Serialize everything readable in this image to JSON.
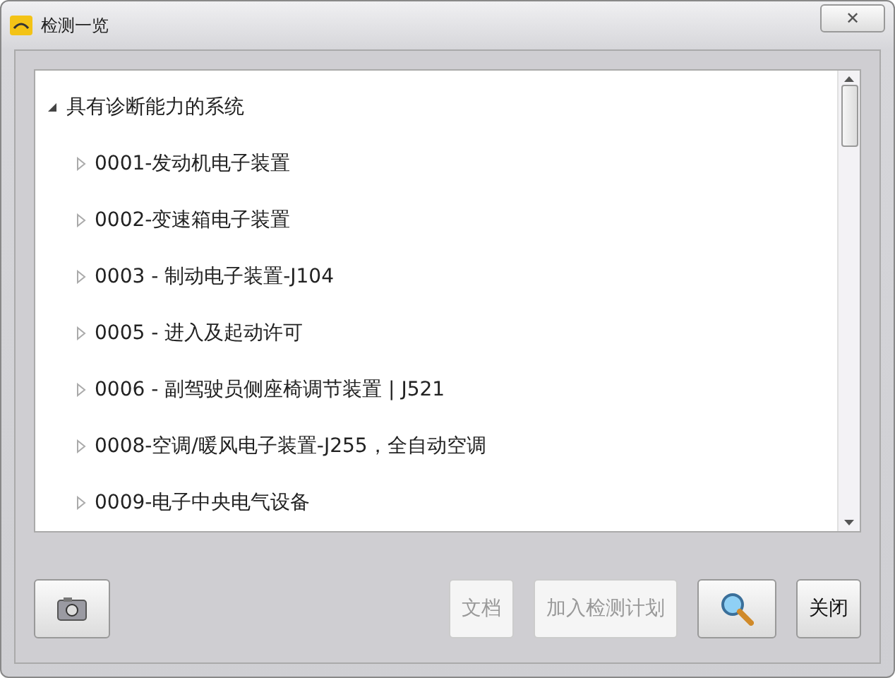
{
  "window": {
    "title": "检测一览",
    "close_symbol": "✕"
  },
  "tree": [
    {
      "label": "具有诊断能力的系统",
      "expanded": true,
      "children": [
        {
          "label": "0001-发动机电子装置",
          "expanded": false
        },
        {
          "label": "0002-变速箱电子装置",
          "expanded": false
        },
        {
          "label": "0003 - 制动电子装置-J104",
          "expanded": false
        },
        {
          "label": "0005 - 进入及起动许可",
          "expanded": false
        },
        {
          "label": "0006 - 副驾驶员侧座椅调节装置 | J521",
          "expanded": false
        },
        {
          "label": "0008-空调/暖风电子装置-J255，全自动空调",
          "expanded": false
        },
        {
          "label": "0009-电子中央电气设备",
          "expanded": false
        }
      ]
    }
  ],
  "buttons": [
    {
      "kind": "camera",
      "disabled": false
    },
    {
      "kind": "text",
      "label": "文档",
      "disabled": true
    },
    {
      "kind": "text",
      "label": "加入检测计划",
      "disabled": true
    },
    {
      "kind": "search",
      "disabled": false
    },
    {
      "kind": "text",
      "label": "关闭",
      "disabled": false
    }
  ]
}
